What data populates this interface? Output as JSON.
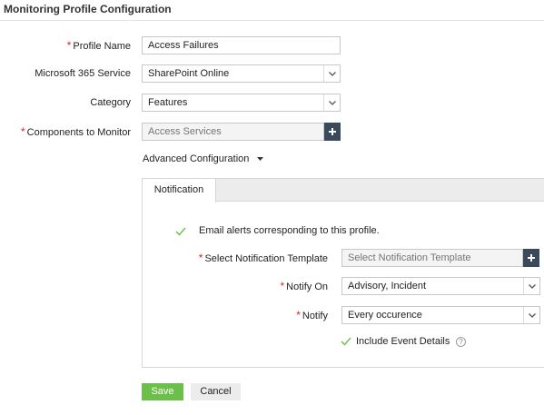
{
  "page": {
    "title": "Monitoring Profile Configuration"
  },
  "form": {
    "profile_name": {
      "label": "Profile Name",
      "value": "Access Failures",
      "required": true
    },
    "service": {
      "label": "Microsoft 365 Service",
      "value": "SharePoint Online"
    },
    "category": {
      "label": "Category",
      "value": "Features"
    },
    "components": {
      "label": "Components to Monitor",
      "placeholder": "Access Services",
      "required": true
    },
    "advanced_label": "Advanced Configuration"
  },
  "notification": {
    "tab_label": "Notification",
    "email_alerts": {
      "label": "Email alerts corresponding to this profile.",
      "checked": true
    },
    "template": {
      "label": "Select Notification Template",
      "placeholder": "Select Notification Template",
      "required": true
    },
    "notify_on": {
      "label": "Notify On",
      "value": "Advisory, Incident",
      "required": true
    },
    "notify": {
      "label": "Notify",
      "value": "Every occurence",
      "required": true
    },
    "include_details": {
      "label": "Include Event Details",
      "checked": true
    }
  },
  "actions": {
    "save_label": "Save",
    "cancel_label": "Cancel"
  },
  "colors": {
    "accent_green": "#6cbf4b",
    "required_red": "#e02020",
    "plus_button": "#3b4a5a"
  }
}
